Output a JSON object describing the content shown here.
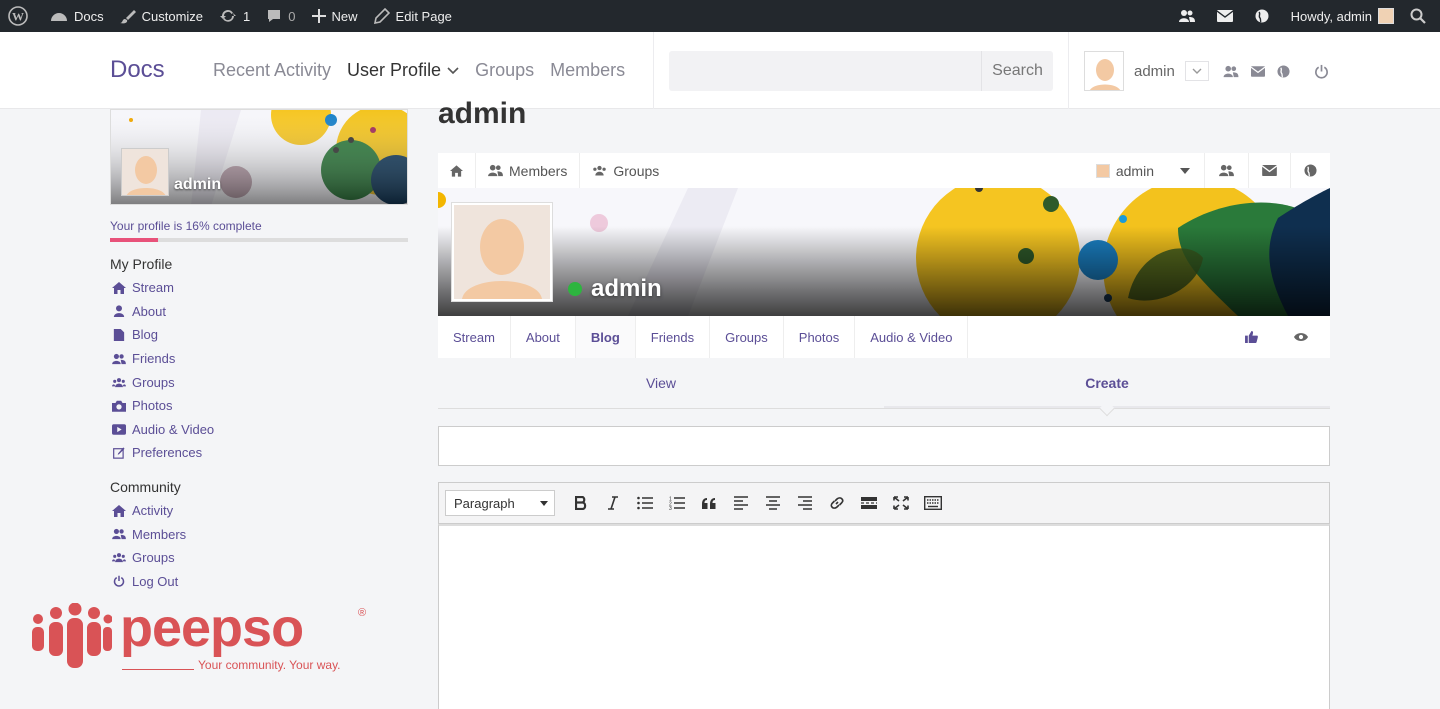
{
  "adminbar": {
    "site": "Docs",
    "customize": "Customize",
    "updates": "1",
    "comments": "0",
    "new": "New",
    "edit_page": "Edit Page",
    "howdy": "Howdy, admin"
  },
  "header": {
    "brand": "Docs",
    "nav": [
      "Recent Activity",
      "User Profile",
      "Groups",
      "Members"
    ],
    "search_button": "Search",
    "search_placeholder": "",
    "username": "admin"
  },
  "sidebar": {
    "cover_name": "admin",
    "progress_text": "Your profile is 16% complete",
    "progress_fraction": 0.16,
    "my_profile_heading": "My Profile",
    "my_profile_items": [
      "Stream",
      "About",
      "Blog",
      "Friends",
      "Groups",
      "Photos",
      "Audio & Video",
      "Preferences"
    ],
    "community_heading": "Community",
    "community_items": [
      "Activity",
      "Members",
      "Groups",
      "Log Out"
    ]
  },
  "main": {
    "page_title": "admin",
    "focus": {
      "members": "Members",
      "groups": "Groups",
      "user": "admin"
    },
    "profile_name": "admin",
    "tabs": [
      "Stream",
      "About",
      "Blog",
      "Friends",
      "Groups",
      "Photos",
      "Audio & Video"
    ],
    "active_tab": "Blog",
    "view_label": "View",
    "create_label": "Create",
    "editor": {
      "format": "Paragraph"
    }
  },
  "peepso": {
    "word": "peepso",
    "reg": "®",
    "tagline": "Your community. Your way."
  },
  "colors": {
    "accent": "#5b4e96",
    "adminbar": "#23282d",
    "progress": "#e8527a",
    "online": "#2db53f",
    "logo": "#d95356"
  }
}
